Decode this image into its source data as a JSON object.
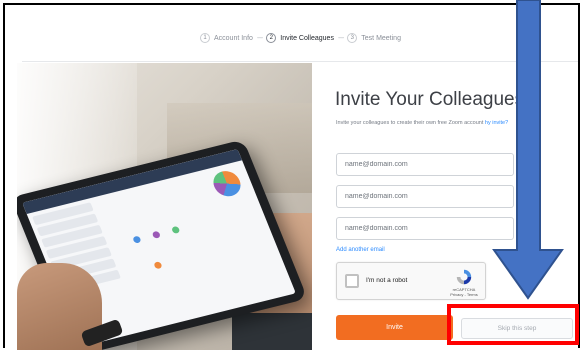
{
  "stepper": {
    "steps": [
      {
        "num": "1",
        "label": "Account Info"
      },
      {
        "num": "2",
        "label": "Invite Colleagues"
      },
      {
        "num": "3",
        "label": "Test Meeting"
      }
    ],
    "separator": "----",
    "active_index": 1
  },
  "form": {
    "title": "Invite Your Colleagues",
    "subtitle_prefix": "Invite your colleagues to create their own free Zoom account",
    "subtitle_link": "hy invite?",
    "email_placeholders": [
      "name@domain.com",
      "name@domain.com",
      "name@domain.com"
    ],
    "add_email_label": "Add another email",
    "invite_label": "Invite",
    "skip_label": "Skip this step"
  },
  "captcha": {
    "label": "I'm not a robot",
    "brand": "reCAPTCHA",
    "links": "Privacy - Terms"
  },
  "colors": {
    "accent": "#f26d21",
    "link": "#2d8cff",
    "highlight": "#ff0000",
    "arrow": "#4472c4"
  },
  "icons": {
    "captcha_logo": "recaptcha-icon",
    "annotation_arrow": "arrow-down-icon"
  }
}
